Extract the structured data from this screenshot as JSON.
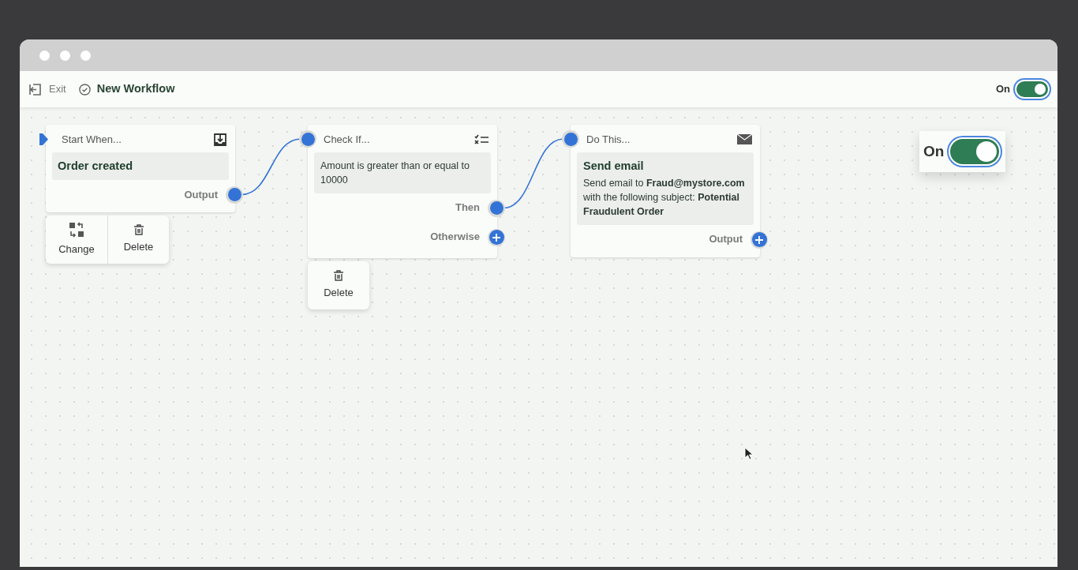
{
  "toolbar": {
    "exit_label": "Exit",
    "title": "New Workflow",
    "toggle": {
      "label": "On",
      "on": true
    }
  },
  "nodes": [
    {
      "kind": "trigger",
      "header": "Start When...",
      "title": "Order created",
      "outputs": [
        {
          "label": "Output",
          "connected": true
        }
      ],
      "actions": [
        {
          "kind": "change",
          "label": "Change"
        },
        {
          "kind": "delete",
          "label": "Delete"
        }
      ]
    },
    {
      "kind": "condition",
      "header": "Check If...",
      "body": "Amount is greater than or equal to 10000",
      "outputs": [
        {
          "label": "Then",
          "connected": true
        },
        {
          "label": "Otherwise",
          "connected": false
        }
      ],
      "actions": [
        {
          "kind": "delete",
          "label": "Delete"
        }
      ]
    },
    {
      "kind": "action",
      "header": "Do This...",
      "title": "Send email",
      "body": "Send email to **Fraud@mystore.com** with the following subject: **Potential Fraudulent Order**",
      "outputs": [
        {
          "label": "Output",
          "connected": false
        }
      ]
    }
  ],
  "toggle_callout": {
    "label": "On",
    "on": true
  }
}
